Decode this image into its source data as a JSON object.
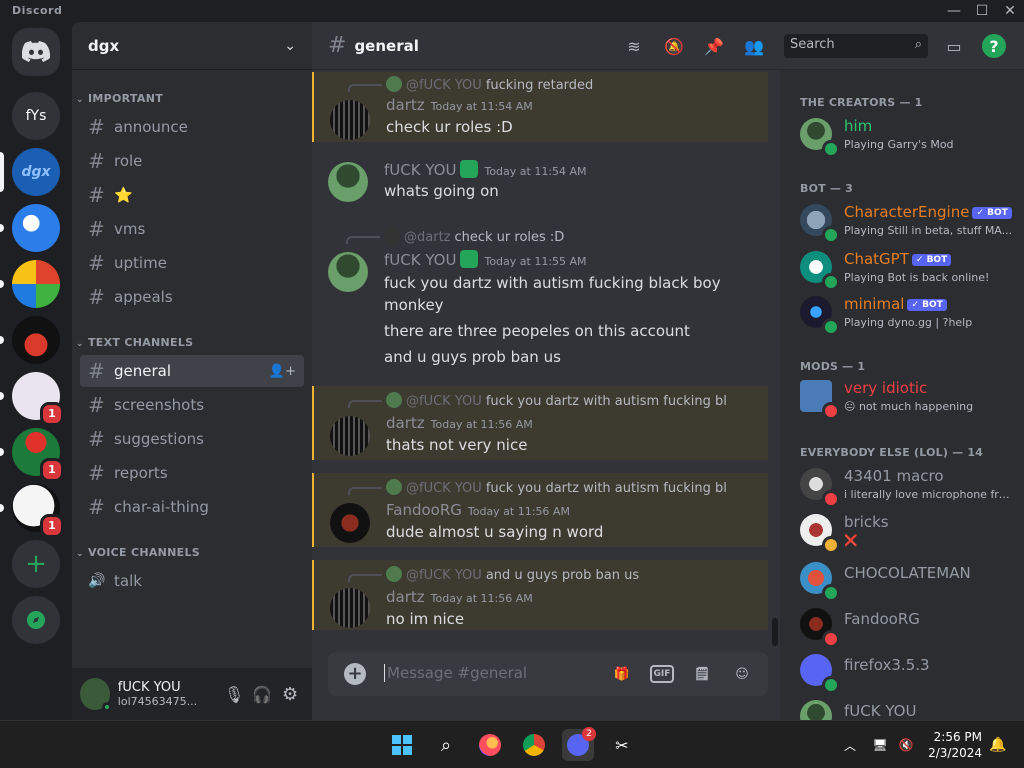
{
  "app": {
    "name": "Discord"
  },
  "rail": {
    "servers": [
      {
        "label": "",
        "badge": ""
      },
      {
        "label": "fYs",
        "badge": ""
      },
      {
        "label": "dgx",
        "badge": ""
      },
      {
        "label": "",
        "badge": ""
      },
      {
        "label": "",
        "badge": ""
      },
      {
        "label": "",
        "badge": ""
      },
      {
        "label": "",
        "badge": "1"
      },
      {
        "label": "",
        "badge": "1"
      },
      {
        "label": "",
        "badge": "1"
      }
    ],
    "add": "+"
  },
  "guild": {
    "name": "dgx"
  },
  "categories": {
    "important": "IMPORTANT",
    "text": "TEXT CHANNELS",
    "voice": "VOICE CHANNELS"
  },
  "channels": {
    "important": [
      "announce",
      "role",
      "⭐",
      "vms",
      "uptime",
      "appeals"
    ],
    "text": [
      "general",
      "screenshots",
      "suggestions",
      "reports",
      "char-ai-thing"
    ],
    "voice": [
      "talk"
    ]
  },
  "user": {
    "name": "fUCK YOU",
    "tag": "lol74563475..."
  },
  "header": {
    "channel": "general",
    "search_placeholder": "Search"
  },
  "messages": [
    {
      "reply_author": "@fUCK YOU",
      "reply_text": "fucking retarded",
      "author": "dartz",
      "time": "Today at 11:54 AM",
      "lines": [
        "check ur roles :D"
      ]
    },
    {
      "reply_author": "",
      "reply_text": "",
      "author": "fUCK YOU",
      "time": "Today at 11:54 AM",
      "lines": [
        "whats going on"
      ]
    },
    {
      "reply_author": "@dartz",
      "reply_text": "check ur roles :D",
      "author": "fUCK YOU",
      "time": "Today at 11:55 AM",
      "lines": [
        "fuck you dartz with autism fucking black boy monkey",
        "there are three peopeles on this account",
        "and u guys prob ban us"
      ]
    },
    {
      "reply_author": "@fUCK YOU",
      "reply_text": "fuck you dartz with autism fucking black",
      "author": "dartz",
      "time": "Today at 11:56 AM",
      "lines": [
        "thats not very nice"
      ]
    },
    {
      "reply_author": "@fUCK YOU",
      "reply_text": "fuck you dartz with autism fucking black",
      "author": "FandooRG",
      "time": "Today at 11:56 AM",
      "lines": [
        "dude almost u saying n word"
      ]
    },
    {
      "reply_author": "@fUCK YOU",
      "reply_text": "and u guys prob ban us",
      "author": "dartz",
      "time": "Today at 11:56 AM",
      "lines": [
        "no im nice"
      ]
    }
  ],
  "composer": {
    "placeholder": "Message #general",
    "gif": "GIF"
  },
  "members": {
    "creators_label": "THE CREATORS — 1",
    "bot_label": "BOT — 3",
    "mods_label": "MODS — 1",
    "everybody_label": "EVERYBODY ELSE (LOL) — 14",
    "bot_badge": "✓ BOT",
    "list": [
      {
        "name": "him",
        "status": "Playing Garry's Mod",
        "color": "#2dc770"
      },
      {
        "name": "CharacterEngine",
        "status": "Playing Still in beta, stuff MA...",
        "color": "#e67e22"
      },
      {
        "name": "ChatGPT",
        "status": "Playing Bot is back online!",
        "color": "#e67e22"
      },
      {
        "name": "minimal",
        "status": "Playing dyno.gg | ?help",
        "color": "#e67e22"
      },
      {
        "name": "very idiotic",
        "status": "😐 not much happening",
        "color": "#f23f43"
      },
      {
        "name": "43401 macro",
        "status": "i literally love microphone fro...",
        "color": "#949ba4"
      },
      {
        "name": "bricks",
        "status": "❌",
        "color": "#949ba4"
      },
      {
        "name": "CHOCOLATEMAN",
        "status": "",
        "color": "#949ba4"
      },
      {
        "name": "FandooRG",
        "status": "",
        "color": "#949ba4"
      },
      {
        "name": "firefox3.5.3",
        "status": "",
        "color": "#949ba4"
      },
      {
        "name": "fUCK YOU",
        "status": "",
        "color": "#949ba4"
      }
    ]
  },
  "taskbar": {
    "time": "2:56 PM",
    "date": "2/3/2024",
    "discord_badge": "2"
  }
}
